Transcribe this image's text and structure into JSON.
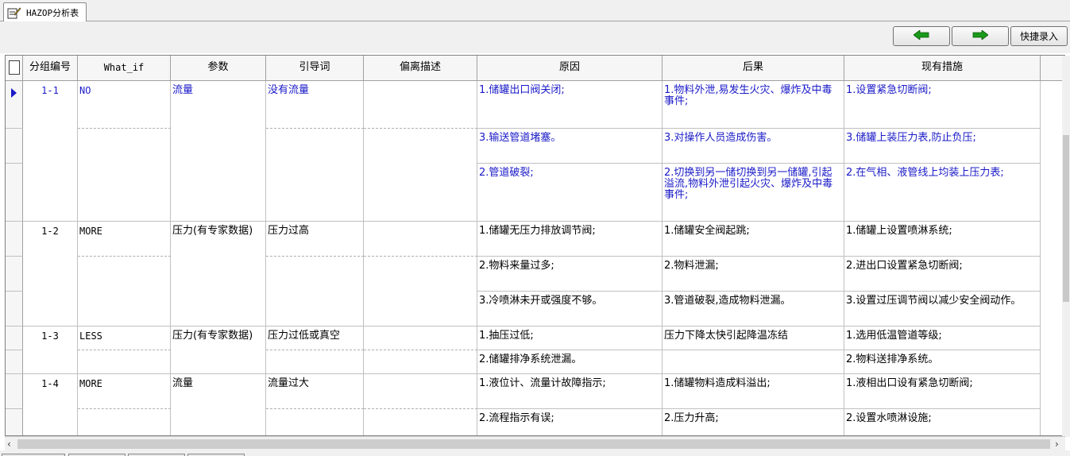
{
  "tab": {
    "label": "HAZOP分析表"
  },
  "toolbar": {
    "prev_icon": "arrow-left-icon",
    "next_icon": "arrow-right-icon",
    "quick_entry_label": "快捷录入",
    "arrow_color": "#1a9a1a"
  },
  "grid": {
    "columns": [
      "分组编号",
      "What_if",
      "参数",
      "引导词",
      "偏离描述",
      "原因",
      "后果",
      "现有措施"
    ],
    "selected_color": "#1a1ac8",
    "groups": [
      {
        "id": "1-1",
        "what_if": "NO",
        "parameter": "流量",
        "guide_word": "没有流量",
        "deviation": "",
        "rows": [
          {
            "cause": "1.储罐出口阀关闭;",
            "consequence": "1.物料外泄,易发生火灾、爆炸及中毒事件;",
            "measure": "1.设置紧急切断阀;"
          },
          {
            "cause": "3.输送管道堵塞。",
            "consequence": "3.对操作人员造成伤害。",
            "measure": "3.储罐上装压力表,防止负压;"
          },
          {
            "cause": "2.管道破裂;",
            "consequence": "2.切换到另一储切换到另一储罐,引起溢流,物料外泄引起火灾、爆炸及中毒事件;",
            "measure": "2.在气相、液管线上均装上压力表;"
          }
        ]
      },
      {
        "id": "1-2",
        "what_if": "MORE",
        "parameter": "压力(有专家数据)",
        "guide_word": "压力过高",
        "deviation": "",
        "rows": [
          {
            "cause": "1.储罐无压力排放调节阀;",
            "consequence": "1.储罐安全阀起跳;",
            "measure": "1.储罐上设置喷淋系统;"
          },
          {
            "cause": "2.物料来量过多;",
            "consequence": "2.物料泄漏;",
            "measure": "2.进出口设置紧急切断阀;"
          },
          {
            "cause": "3.冷喷淋未开或强度不够。",
            "consequence": "3.管道破裂,造成物料泄漏。",
            "measure": "3.设置过压调节阀以减少安全阀动作。"
          }
        ]
      },
      {
        "id": "1-3",
        "what_if": "LESS",
        "parameter": "压力(有专家数据)",
        "guide_word": "压力过低或真空",
        "deviation": "",
        "rows": [
          {
            "cause": "1.抽压过低;",
            "consequence": "压力下降太快引起降温冻结",
            "measure": "1.选用低温管道等级;"
          },
          {
            "cause": "2.储罐排净系统泄漏。",
            "consequence": "",
            "measure": "2.物料送排净系统。"
          }
        ]
      },
      {
        "id": "1-4",
        "what_if": "MORE",
        "parameter": "流量",
        "guide_word": "流量过大",
        "deviation": "",
        "rows": [
          {
            "cause": "1.液位计、流量计故障指示;",
            "consequence": "1.储罐物料造成料溢出;",
            "measure": "1.液相出口设有紧急切断阀;"
          },
          {
            "cause": "2.流程指示有误;",
            "consequence": "2.压力升高;",
            "measure": "2.设置水喷淋设施;"
          }
        ]
      }
    ]
  }
}
